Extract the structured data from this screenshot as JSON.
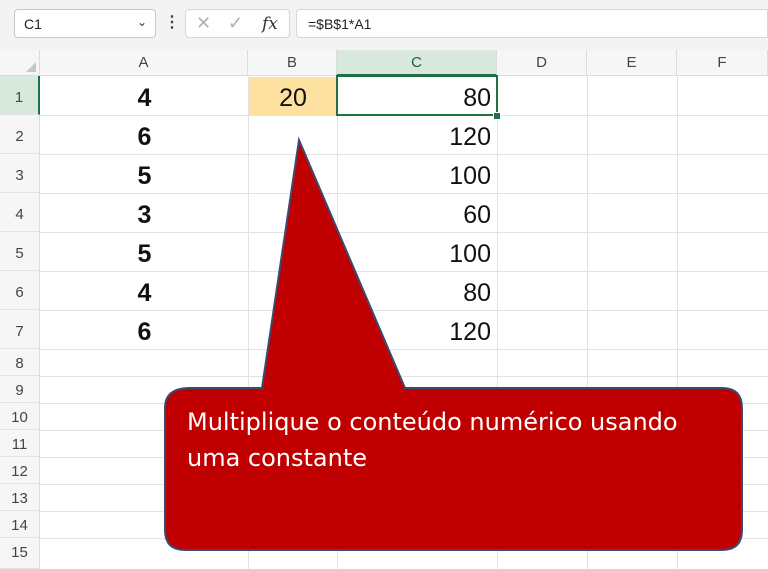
{
  "name_box": {
    "value": "C1"
  },
  "formula_bar": {
    "value": "=$B$1*A1"
  },
  "columns": [
    "A",
    "B",
    "C",
    "D",
    "E",
    "F"
  ],
  "rows": [
    "1",
    "2",
    "3",
    "4",
    "5",
    "6",
    "7",
    "8",
    "9",
    "10",
    "11",
    "12",
    "13",
    "14",
    "15"
  ],
  "column_a": [
    "4",
    "6",
    "5",
    "3",
    "5",
    "4",
    "6"
  ],
  "cell_b1": "20",
  "column_c": [
    "80",
    "120",
    "100",
    "60",
    "100",
    "80",
    "120"
  ],
  "callout": {
    "line1": "Multiplique o conteúdo numérico usando",
    "line2": "uma constante",
    "color": "#c00000"
  },
  "accent": "#1e7145",
  "highlight": "#fde1a0"
}
